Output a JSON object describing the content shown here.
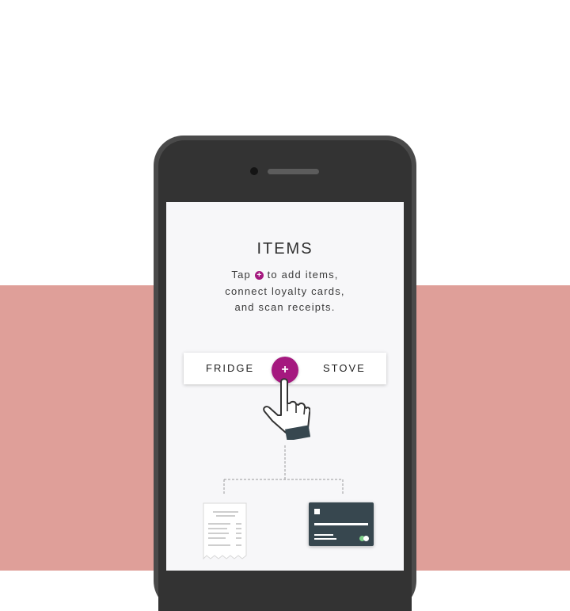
{
  "colors": {
    "page_background": "#ffffff",
    "band": "#df9f99",
    "accent": "#a5197f",
    "card": "#37474f"
  },
  "screen": {
    "title": "ITEMS",
    "description": {
      "before_icon": "Tap ",
      "icon": "+",
      "after_icon": " to add items,",
      "line2": "connect loyalty cards,",
      "line3": "and scan receipts."
    },
    "tabs": {
      "left": "FRIDGE",
      "right": "STOVE"
    },
    "fab_label": "+"
  },
  "icons": {
    "phone_camera": "camera-dot",
    "phone_speaker": "speaker-slot",
    "hand": "pointing-hand-icon",
    "receipt": "receipt-icon",
    "loyalty_card": "loyalty-card-icon"
  }
}
